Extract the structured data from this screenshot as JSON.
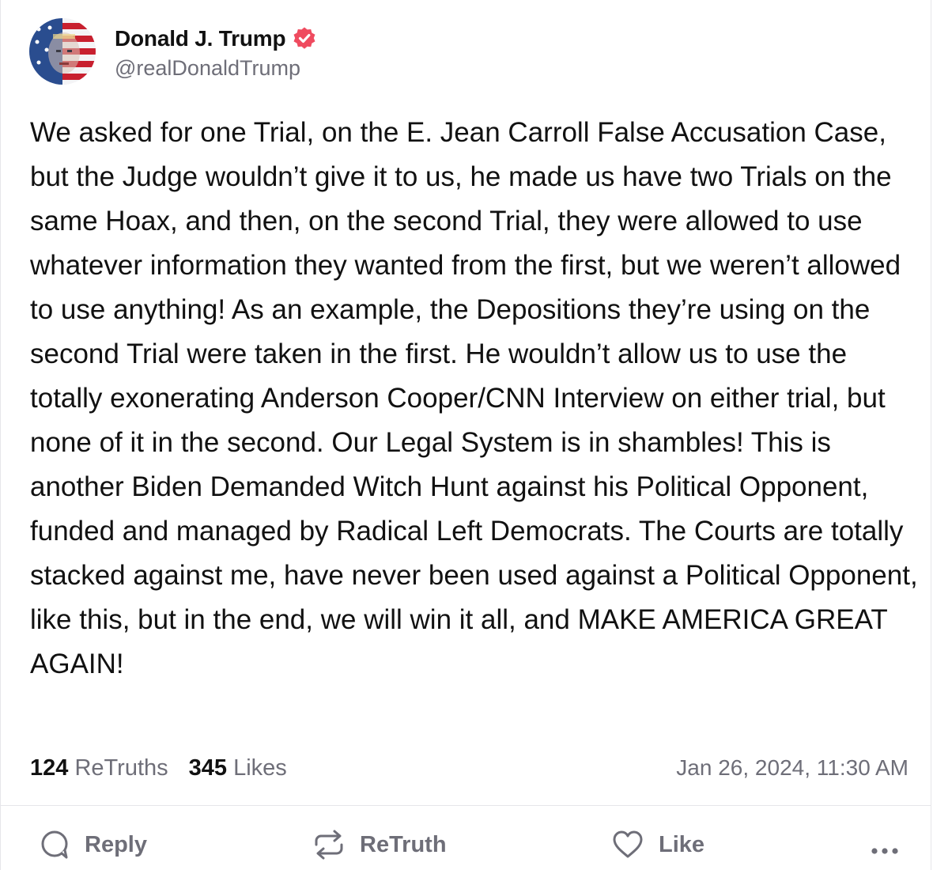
{
  "author": {
    "display_name": "Donald J. Trump",
    "handle": "@realDonaldTrump",
    "verified": true,
    "verified_color": "#ef4b5f",
    "avatar_icon": "flag-portrait-avatar"
  },
  "post": {
    "text": "We asked for one Trial, on the E. Jean Carroll False Accusation Case, but the Judge wouldn’t give it to us, he made us have two Trials on the same Hoax, and then, on the second Trial, they were allowed to use whatever information they wanted from the first, but we weren’t allowed to use anything! As an example, the Depositions they’re using on the second Trial were taken in the first. He wouldn’t allow us to use the totally exonerating Anderson Cooper/CNN Interview on either trial, but none of it in the second. Our Legal System is in shambles! This is another Biden Demanded Witch Hunt against his Political Opponent, funded and managed by Radical Left Democrats. The Courts are totally stacked against me, have never been used against a Political Opponent, like this, but in the end, we will win it all, and MAKE AMERICA GREAT AGAIN!"
  },
  "stats": {
    "retruths_count": "124",
    "retruths_label": "ReTruths",
    "likes_count": "345",
    "likes_label": "Likes",
    "timestamp": "Jan 26, 2024, 11:30 AM"
  },
  "actions": {
    "reply_label": "Reply",
    "retruth_label": "ReTruth",
    "like_label": "Like",
    "reply_icon": "speech-bubble-icon",
    "retruth_icon": "repost-arrows-icon",
    "like_icon": "heart-icon",
    "more_icon": "ellipsis-icon"
  },
  "colors": {
    "text_primary": "#111111",
    "text_secondary": "#6e6e78",
    "divider": "#e6e6ea"
  }
}
